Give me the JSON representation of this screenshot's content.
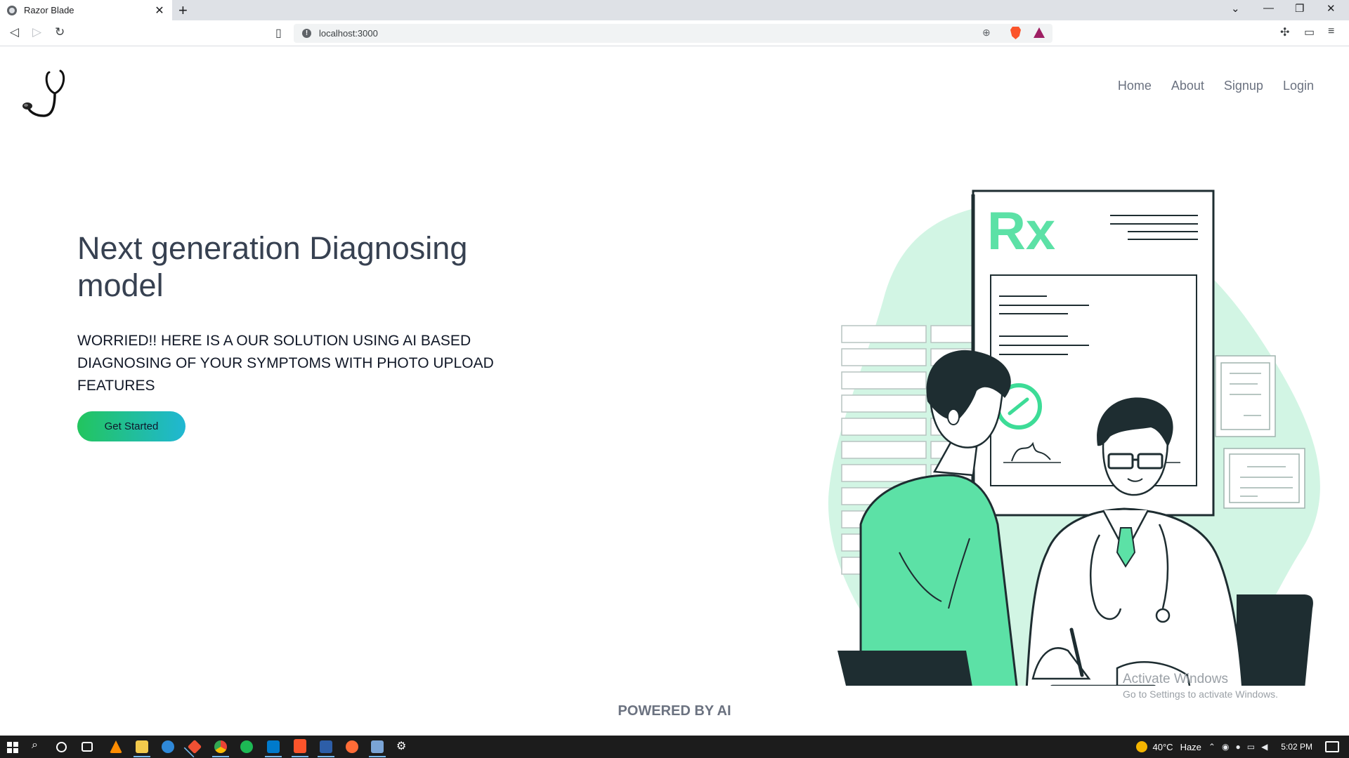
{
  "browser": {
    "tab_title": "Razor Blade",
    "url": "localhost:3000"
  },
  "nav": {
    "items": [
      {
        "label": "Home"
      },
      {
        "label": "About"
      },
      {
        "label": "Signup"
      },
      {
        "label": "Login"
      }
    ]
  },
  "hero": {
    "title": "Next generation Diagnosing model",
    "subtitle": "WORRIED!! HERE IS A OUR SOLUTION USING AI BASED DIAGNOSING OF YOUR SYMPTOMS WITH PHOTO UPLOAD FEATURES",
    "cta_label": "Get Started"
  },
  "illustration": {
    "rx_text": "Rx",
    "accent_color": "#5ce1a6",
    "dark_color": "#1e2d31"
  },
  "footer": {
    "text": "POWERED BY AI"
  },
  "watermark": {
    "line1": "Activate Windows",
    "line2": "Go to Settings to activate Windows."
  },
  "taskbar": {
    "weather_temp": "40°C",
    "weather_desc": "Haze",
    "time": "5:02 PM"
  }
}
